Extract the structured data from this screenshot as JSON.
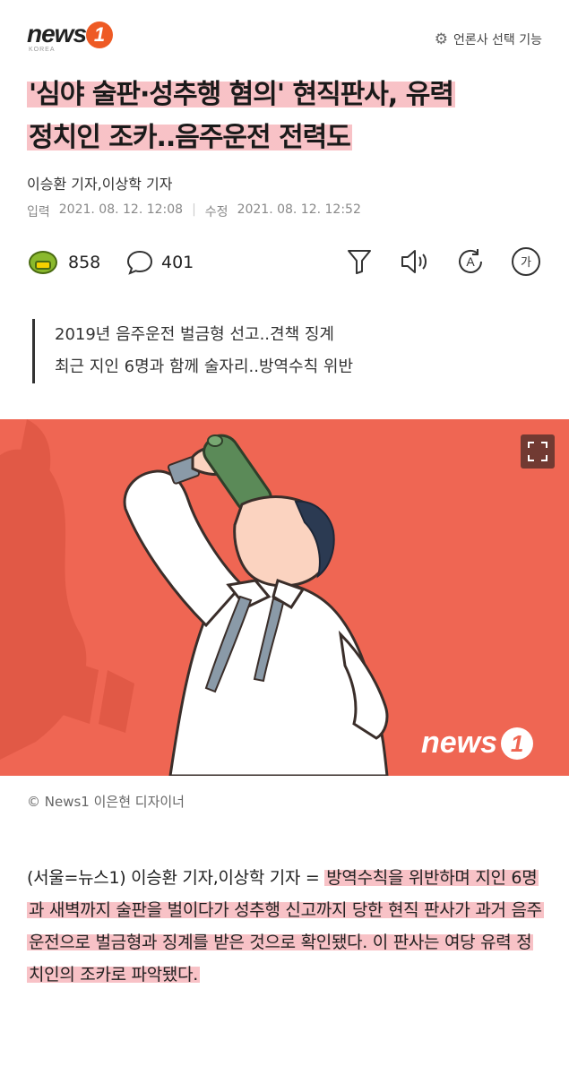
{
  "header": {
    "logo_word": "news",
    "logo_badge": "1",
    "logo_sub": "KOREA",
    "media_select_label": "언론사 선택 기능",
    "media_select_icon": "gear-icon"
  },
  "article": {
    "headline_line1": "'심야 술판·성추행 혐의' 현직판사, 유력",
    "headline_line2": "정치인 조카..음주운전 전력도",
    "reporters": "이승환 기자,이상학 기자",
    "input_label": "입력",
    "input_time": "2021. 08. 12. 12:08",
    "modify_label": "수정",
    "modify_time": "2021. 08. 12. 12:52"
  },
  "actions": {
    "reaction_count": "858",
    "comment_count": "401",
    "icons": [
      "filter-icon",
      "speaker-icon",
      "translate-icon",
      "font-size-icon"
    ],
    "font_size_glyph": "가",
    "translate_glyph": "A"
  },
  "summary": {
    "line1": "2019년 음주운전 벌금형 선고..견책 징계",
    "line2": "최근 지인 6명과 함께 술자리..방역수칙 위반"
  },
  "photo": {
    "watermark_word": "news",
    "watermark_badge": "1",
    "caption": "© News1 이은현 디자이너",
    "accent_color": "#ef6653"
  },
  "body": {
    "intro": "(서울=뉴스1) 이승환 기자,이상학 기자 = ",
    "highlight": "방역수칙을 위반하며 지인 6명과 새벽까지 술판을 벌이다가 성추행 신고까지 당한 현직 판사가 과거 음주운전으로 벌금형과 징계를 받은 것으로 확인됐다. 이 판사는 여당 유력 정치인의 조카로 파악됐다."
  },
  "colors": {
    "highlight": "#f07882",
    "brand": "#ee5a24"
  }
}
